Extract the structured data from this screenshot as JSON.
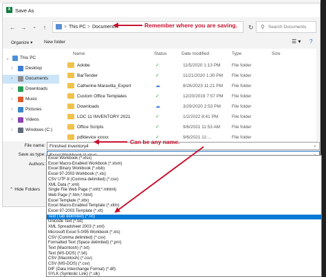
{
  "window": {
    "title": "Save As",
    "app_icon_letter": "X"
  },
  "nav": {
    "back_icon": "arrow-left-icon",
    "forward_icon": "arrow-right-icon",
    "recent_icon": "chevron-down-icon",
    "up_icon": "arrow-up-icon",
    "breadcrumb": [
      "This PC",
      "Documents"
    ],
    "breadcrumb_sep": ">",
    "search_placeholder": "Search Documents"
  },
  "annotations": {
    "location": "Remember where you are saving.",
    "filename": "Can be any name."
  },
  "toolbar": {
    "organize": "Organize",
    "new_folder": "New folder"
  },
  "sidebar": [
    {
      "label": "This PC",
      "color": "#4a8fd8",
      "selected": false
    },
    {
      "label": "Desktop",
      "color": "#3b7fd4",
      "selected": false
    },
    {
      "label": "Documents",
      "color": "#8a8a8a",
      "selected": true
    },
    {
      "label": "Downloads",
      "color": "#2a9d54",
      "selected": false
    },
    {
      "label": "Music",
      "color": "#e05a2a",
      "selected": false
    },
    {
      "label": "Pictures",
      "color": "#3a86c8",
      "selected": false
    },
    {
      "label": "Videos",
      "color": "#8e44ad",
      "selected": false
    },
    {
      "label": "Windows (C:)",
      "color": "#5f6b7a",
      "selected": false
    }
  ],
  "columns": {
    "name": "Name",
    "status": "Status",
    "date": "Date modified",
    "type": "Type",
    "size": "Size"
  },
  "files": [
    {
      "name": "Adobe",
      "status": "check",
      "date": "11/5/2020 1:13 PM",
      "type": "File folder"
    },
    {
      "name": "BarTender",
      "status": "check",
      "date": "11/21/2020 1:30 PM",
      "type": "File folder"
    },
    {
      "name": "Catherine Maravilla_Export",
      "status": "cloud",
      "date": "8/26/2023 11:21 PM",
      "type": "File folder"
    },
    {
      "name": "Custom Office Templates",
      "status": "check",
      "date": "12/20/2019 7:57 PM",
      "type": "File folder"
    },
    {
      "name": "Downloads",
      "status": "cloud",
      "date": "3/29/2020 2:53 PM",
      "type": "File folder"
    },
    {
      "name": "LOC 11 INVENTORY 2021",
      "status": "check",
      "date": "1/2/2022 8:41 PM",
      "type": "File folder"
    },
    {
      "name": "Office Scripts",
      "status": "check",
      "date": "9/6/2021 11:53 AM",
      "type": "File folder"
    },
    {
      "name": "pdfdevice xxxxx",
      "status": "check",
      "date": "9/6/2021 11:...",
      "type": "File folder"
    }
  ],
  "form": {
    "filename_label": "File name:",
    "filename_value": "Finished Inventory4",
    "saveas_label": "Save as type:",
    "saveas_value": "Excel Workbook (*.xlsx)",
    "authors_label": "Authors:",
    "hide_folders": "Hide Folders"
  },
  "file_types": [
    "Excel Workbook (*.xlsx)",
    "Excel Macro-Enabled Workbook (*.xlsm)",
    "Excel Binary Workbook (*.xlsb)",
    "Excel 97-2003 Workbook (*.xls)",
    "CSV UTF-8 (Comma delimited) (*.csv)",
    "XML Data (*.xml)",
    "Single File Web Page (*.mht;*.mhtml)",
    "Web Page (*.htm;*.html)",
    "Excel Template (*.xltx)",
    "Excel Macro-Enabled Template (*.xltm)",
    "Excel 97-2003 Template (*.xlt)",
    "Text (Tab delimited) (*.txt)",
    "Unicode Text (*.txt)",
    "XML Spreadsheet 2003 (*.xml)",
    "Microsoft Excel 5.0/95 Workbook (*.xls)",
    "CSV (Comma delimited) (*.csv)",
    "Formatted Text (Space delimited) (*.prn)",
    "Text (Macintosh) (*.txt)",
    "Text (MS-DOS) (*.txt)",
    "CSV (Macintosh) (*.csv)",
    "CSV (MS-DOS) (*.csv)",
    "DIF (Data Interchange Format) (*.dif)",
    "SYLK (Symbolic Link) (*.slk)"
  ],
  "selected_file_type_index": 11,
  "colors": {
    "annotation_red": "#c8102e",
    "selection_blue": "#0078d7"
  }
}
